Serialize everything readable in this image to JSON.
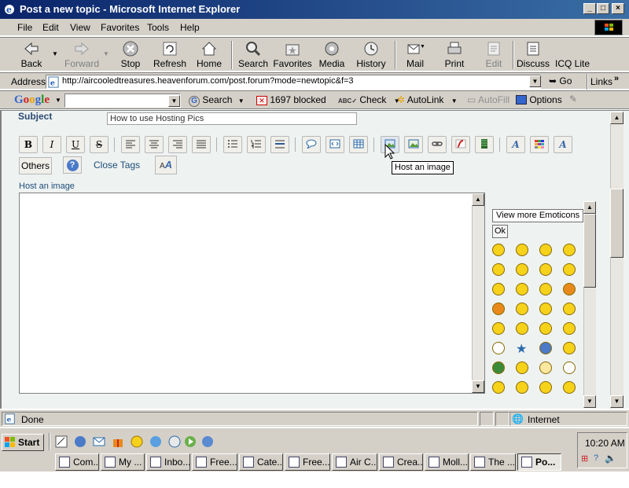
{
  "window": {
    "title": "Post a new topic - Microsoft Internet Explorer"
  },
  "menu": [
    "File",
    "Edit",
    "View",
    "Favorites",
    "Tools",
    "Help"
  ],
  "toolbar": [
    {
      "label": "Back",
      "icon": "back-arrow-icon"
    },
    {
      "label": "Forward",
      "icon": "forward-arrow-icon",
      "disabled": true
    },
    {
      "label": "Stop",
      "icon": "stop-icon"
    },
    {
      "label": "Refresh",
      "icon": "refresh-icon"
    },
    {
      "label": "Home",
      "icon": "home-icon"
    },
    {
      "label": "Search",
      "icon": "search-icon"
    },
    {
      "label": "Favorites",
      "icon": "favorites-icon"
    },
    {
      "label": "Media",
      "icon": "media-icon"
    },
    {
      "label": "History",
      "icon": "history-icon"
    },
    {
      "label": "Mail",
      "icon": "mail-icon"
    },
    {
      "label": "Print",
      "icon": "print-icon"
    },
    {
      "label": "Edit",
      "icon": "edit-icon",
      "disabled": true
    },
    {
      "label": "Discuss",
      "icon": "discuss-icon"
    },
    {
      "label": "ICQ Lite",
      "icon": "icq-icon"
    }
  ],
  "address": {
    "label": "Address",
    "url": "http://aircooledtreasures.heavenforum.com/post.forum?mode=newtopic&f=3",
    "go": "Go",
    "links": "Links"
  },
  "googlebar": {
    "logo": "Google",
    "search": "Search",
    "blocked": "1697 blocked",
    "check": "Check",
    "autolink": "AutoLink",
    "autofill": "AutoFill",
    "options": "Options"
  },
  "form": {
    "subject_label": "Subject",
    "subject_value": "How to use Hosting Pics",
    "others_label": "Others",
    "close_tags": "Close Tags",
    "host_image_hint": "Host an image",
    "tooltip": "Host an image"
  },
  "emoticons": {
    "view_more": "View more Emoticons",
    "ok": "Ok"
  },
  "status": {
    "text": "Done",
    "zone": "Internet"
  },
  "taskbar": {
    "start": "Start",
    "clock": "10:20 AM",
    "tasks": [
      "Com...",
      "My ...",
      "Inbo...",
      "Free...",
      "Cate...",
      "Free...",
      "Air C...",
      "Crea...",
      "Moll...",
      "The ...",
      "Po..."
    ]
  },
  "colors": {
    "titlebar": "#0a246a",
    "chrome": "#d4d0c8",
    "content_bg": "#eef2f1",
    "link": "#1c4d7a"
  }
}
